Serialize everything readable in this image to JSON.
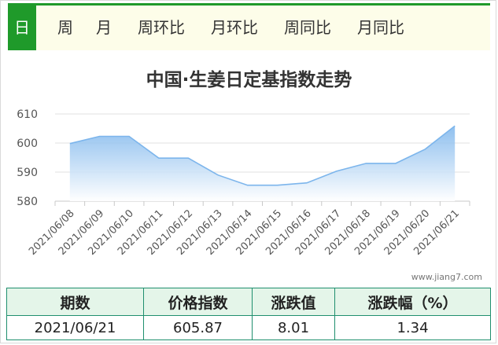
{
  "tabs": [
    {
      "label": "日",
      "active": true
    },
    {
      "label": "周",
      "active": false
    },
    {
      "label": "月",
      "active": false
    },
    {
      "label": "周环比",
      "active": false
    },
    {
      "label": "月环比",
      "active": false
    },
    {
      "label": "周同比",
      "active": false
    },
    {
      "label": "月同比",
      "active": false
    }
  ],
  "chart_data": {
    "type": "area",
    "title": "中国·生姜日定基指数走势",
    "xlabel": "",
    "ylabel": "",
    "categories": [
      "2021/06/08",
      "2021/06/09",
      "2021/06/10",
      "2021/06/11",
      "2021/06/12",
      "2021/06/13",
      "2021/06/14",
      "2021/06/15",
      "2021/06/16",
      "2021/06/17",
      "2021/06/18",
      "2021/06/19",
      "2021/06/20",
      "2021/06/21"
    ],
    "values": [
      599.8,
      602.3,
      602.3,
      594.8,
      594.8,
      589.0,
      585.5,
      585.5,
      586.3,
      590.3,
      593.0,
      593.0,
      597.9,
      605.87
    ],
    "ylim": [
      580,
      610
    ],
    "yticks": [
      580,
      590,
      600,
      610
    ],
    "grid": true,
    "line_color": "#7cb5ec",
    "fill_top_color": "#7cb5ec",
    "fill_bottom_color": "#ffffff"
  },
  "watermark": "www.jiang7.com",
  "summary": {
    "headers": [
      "期数",
      "价格指数",
      "涨跌值",
      "涨跌幅（%）"
    ],
    "row": [
      "2021/06/21",
      "605.87",
      "8.01",
      "1.34"
    ]
  }
}
